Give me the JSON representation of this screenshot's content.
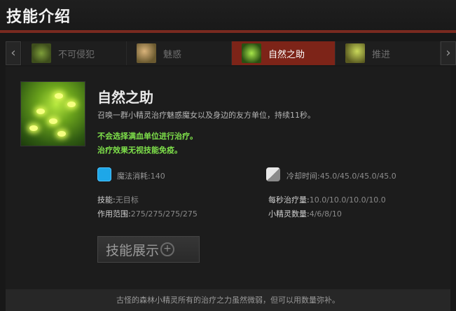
{
  "header": {
    "title": "技能介绍"
  },
  "tabs": [
    {
      "label": "不可侵犯",
      "icon": "ability-icon-enchant-1"
    },
    {
      "label": "魅惑",
      "icon": "ability-icon-enchant-2"
    },
    {
      "label": "自然之助",
      "icon": "ability-icon-natures-attendants",
      "active": true
    },
    {
      "label": "推进",
      "icon": "ability-icon-impetus"
    }
  ],
  "skill": {
    "name": "自然之助",
    "description": "召唤一群小精灵治疗魅惑魔女以及身边的友方单位，持续11秒。",
    "notes": [
      "不会选择满血单位进行治疗。",
      "治疗效果无视技能免疫。"
    ],
    "mana": {
      "label": "魔法消耗:",
      "value": "140"
    },
    "cooldown": {
      "label": "冷却时间:",
      "value": "45.0/45.0/45.0/45.0"
    },
    "ability": {
      "label": "技能:",
      "value": "无目标"
    },
    "heal_per_sec": {
      "label": "每秒治疗量:",
      "value": "10.0/10.0/10.0/10.0"
    },
    "range": {
      "label": "作用范围:",
      "value": "275/275/275/275"
    },
    "wisp_count": {
      "label": "小精灵数量:",
      "value": "4/6/8/10"
    }
  },
  "demo_button": {
    "label": "技能展示"
  },
  "lore": "古怪的森林小精灵所有的治疗之力虽然微弱，但可以用数量弥补。",
  "colors": {
    "accent": "#7d2418",
    "note": "#7ee04a",
    "mana": "#1ea7e8"
  }
}
